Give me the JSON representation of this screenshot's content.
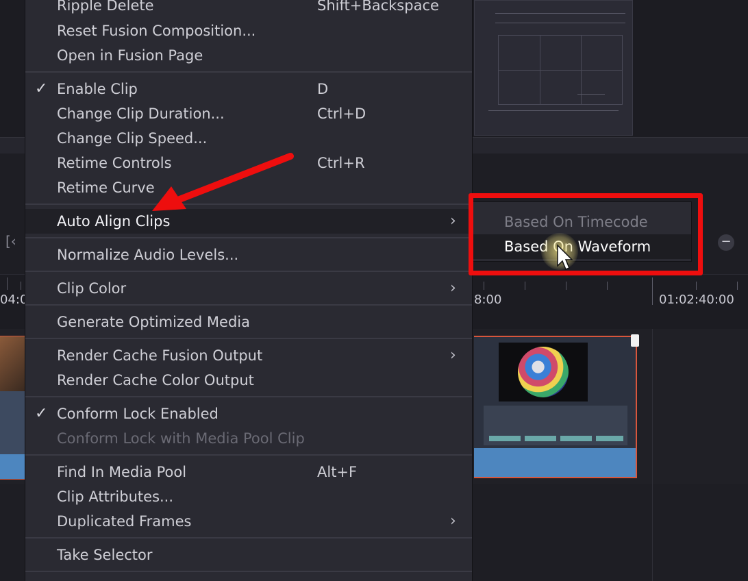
{
  "context_menu": {
    "items": [
      {
        "label": "Ripple Delete",
        "shortcut": "Shift+Backspace"
      },
      {
        "label": "Reset Fusion Composition..."
      },
      {
        "label": "Open in Fusion Page"
      },
      {
        "label": "Enable Clip",
        "shortcut": "D",
        "checked": true
      },
      {
        "label": "Change Clip Duration...",
        "shortcut": "Ctrl+D"
      },
      {
        "label": "Change Clip Speed..."
      },
      {
        "label": "Retime Controls",
        "shortcut": "Ctrl+R"
      },
      {
        "label": "Retime Curve"
      },
      {
        "label": "Auto Align Clips",
        "submenu": true,
        "highlighted": true
      },
      {
        "label": "Normalize Audio Levels..."
      },
      {
        "label": "Clip Color",
        "submenu": true
      },
      {
        "label": "Generate Optimized Media"
      },
      {
        "label": "Render Cache Fusion Output",
        "submenu": true
      },
      {
        "label": "Render Cache Color Output"
      },
      {
        "label": "Conform Lock Enabled",
        "checked": true
      },
      {
        "label": "Conform Lock with Media Pool Clip",
        "disabled": true
      },
      {
        "label": "Find In Media Pool",
        "shortcut": "Alt+F"
      },
      {
        "label": "Clip Attributes..."
      },
      {
        "label": "Duplicated Frames",
        "submenu": true
      },
      {
        "label": "Take Selector"
      }
    ],
    "checkmark": "✓",
    "submenu_arrow": "›"
  },
  "submenu": {
    "items": [
      {
        "label": "Based On Timecode"
      },
      {
        "label": "Based On Waveform",
        "hovered": true
      }
    ]
  },
  "timeline": {
    "timecodes": [
      "04:0",
      "8:00",
      "01:02:40:00"
    ],
    "zoom_out": "−",
    "nav_left": "[‹"
  },
  "colors": {
    "menu_bg": "#2a2a32",
    "menu_text": "#cfcfd6",
    "annotation_red": "#ee0e0e",
    "clip_blue": "#4d86bf",
    "clip_border": "#d8563c"
  }
}
